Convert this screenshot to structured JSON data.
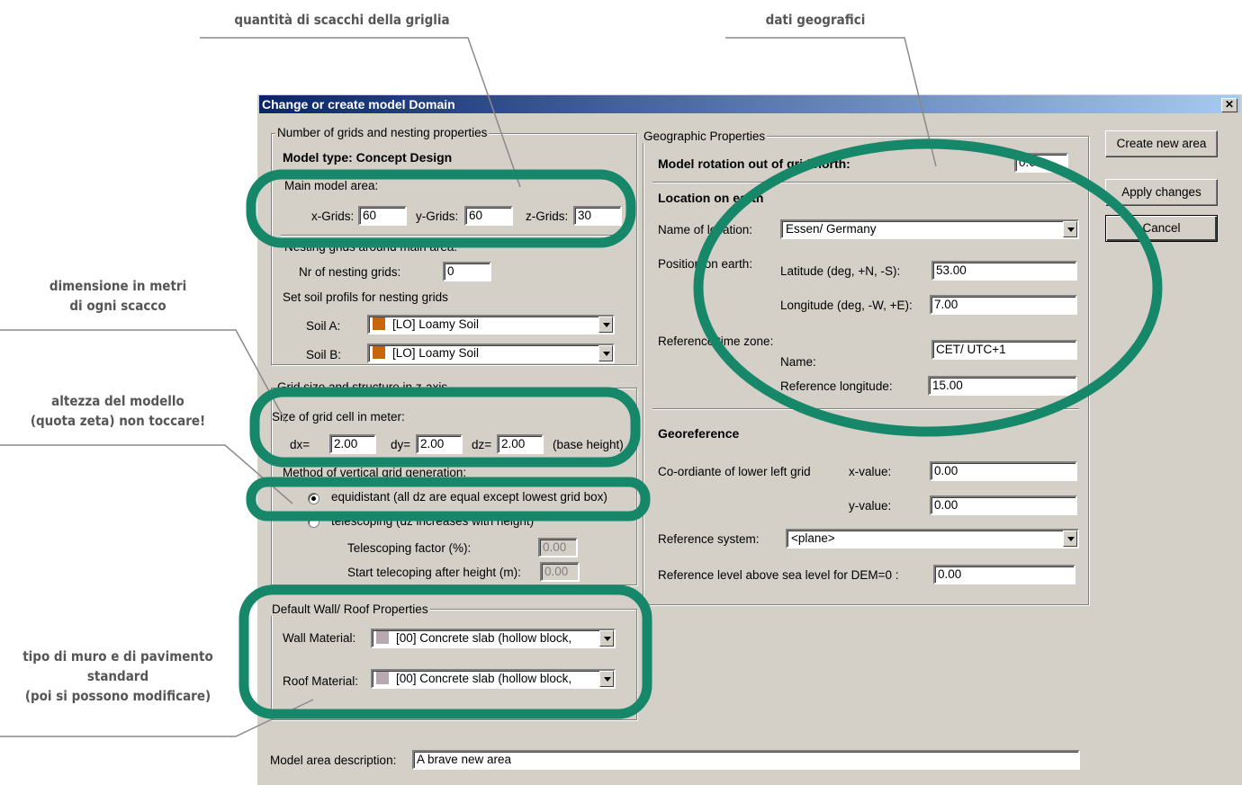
{
  "annotations": {
    "grid_count": "quantità di scacchi della griglia",
    "geo_data": "dati geografici",
    "cell_size": [
      "dimensione in metri",
      "di ogni scacco"
    ],
    "model_height": [
      "altezza del modello",
      "(quota zeta) non toccare!"
    ],
    "wall_roof": [
      "tipo di muro e di pavimento",
      "standard",
      "(poi si possono modificare)"
    ],
    "highlight_color": "#17876a"
  },
  "window": {
    "title": "Change or create model Domain",
    "close": "✕"
  },
  "grids": {
    "group_label": "Number of grids and nesting properties",
    "model_type": "Model type: Concept Design",
    "main_area_label": "Main model area:",
    "x_label": "x-Grids:",
    "x_value": "60",
    "y_label": "y-Grids:",
    "y_value": "60",
    "z_label": "z-Grids:",
    "z_value": "30",
    "nesting_heading": "Nesting grids around main area:",
    "nesting_label": "Nr of nesting grids:",
    "nesting_value": "0",
    "soil_heading": "Set soil profils for nesting grids",
    "soil_a_label": "Soil A:",
    "soil_a_value": "[LO] Loamy Soil",
    "soil_b_label": "Soil B:",
    "soil_b_value": "[LO] Loamy Soil",
    "soil_color": "#c8640a"
  },
  "cells": {
    "group_label": "Grid size and structure in z-axis",
    "size_label": "Size of grid cell in meter:",
    "dx_label": "dx=",
    "dx_value": "2.00",
    "dy_label": "dy=",
    "dy_value": "2.00",
    "dz_label": "dz=",
    "dz_value": "2.00",
    "base_height": "(base height)",
    "method_label": "Method of vertical grid generation:",
    "equidistant": "equidistant (all dz are equal except lowest grid box)",
    "telescoping": "telescoping (dz increases with height)",
    "tel_factor_label": "Telescoping factor (%):",
    "tel_factor_value": "0.00",
    "tel_start_label": "Start telecoping after height (m):",
    "tel_start_value": "0.00"
  },
  "walls": {
    "group_label": "Default Wall/ Roof Properties",
    "wall_label": "Wall Material:",
    "wall_value": "[00] Concrete slab (hollow block,",
    "roof_label": "Roof Material:",
    "roof_value": "[00] Concrete slab (hollow block,",
    "material_color": "#b8a8b0"
  },
  "geo": {
    "group_label": "Geographic Properties",
    "rotation_label": "Model rotation out of grid north:",
    "rotation_value": "0.00",
    "location_heading": "Location on earth",
    "name_label": "Name of location:",
    "name_value": "Essen/ Germany",
    "position_label": "Position on earth:",
    "lat_label": "Latitude (deg, +N, -S):",
    "lat_value": "53.00",
    "lon_label": "Longitude (deg, -W, +E):",
    "lon_value": "7.00",
    "tz_label": "Reference time zone:",
    "tz_name_label": "Name:",
    "tz_name_value": "CET/ UTC+1",
    "ref_lon_label": "Reference longitude:",
    "ref_lon_value": "15.00",
    "georef_heading": "Georeference",
    "coord_label": "Co-ordiante of lower left grid",
    "xval_label": "x-value:",
    "xval_value": "0.00",
    "yval_label": "y-value:",
    "yval_value": "0.00",
    "refsys_label": "Reference system:",
    "refsys_value": "<plane>",
    "refsea_label": "Reference level above sea level for DEM=0 :",
    "refsea_value": "0.00"
  },
  "buttons": {
    "create": "Create new area",
    "apply": "Apply changes",
    "cancel": "Cancel"
  },
  "description": {
    "label": "Model area description:",
    "value": "A brave new area"
  }
}
